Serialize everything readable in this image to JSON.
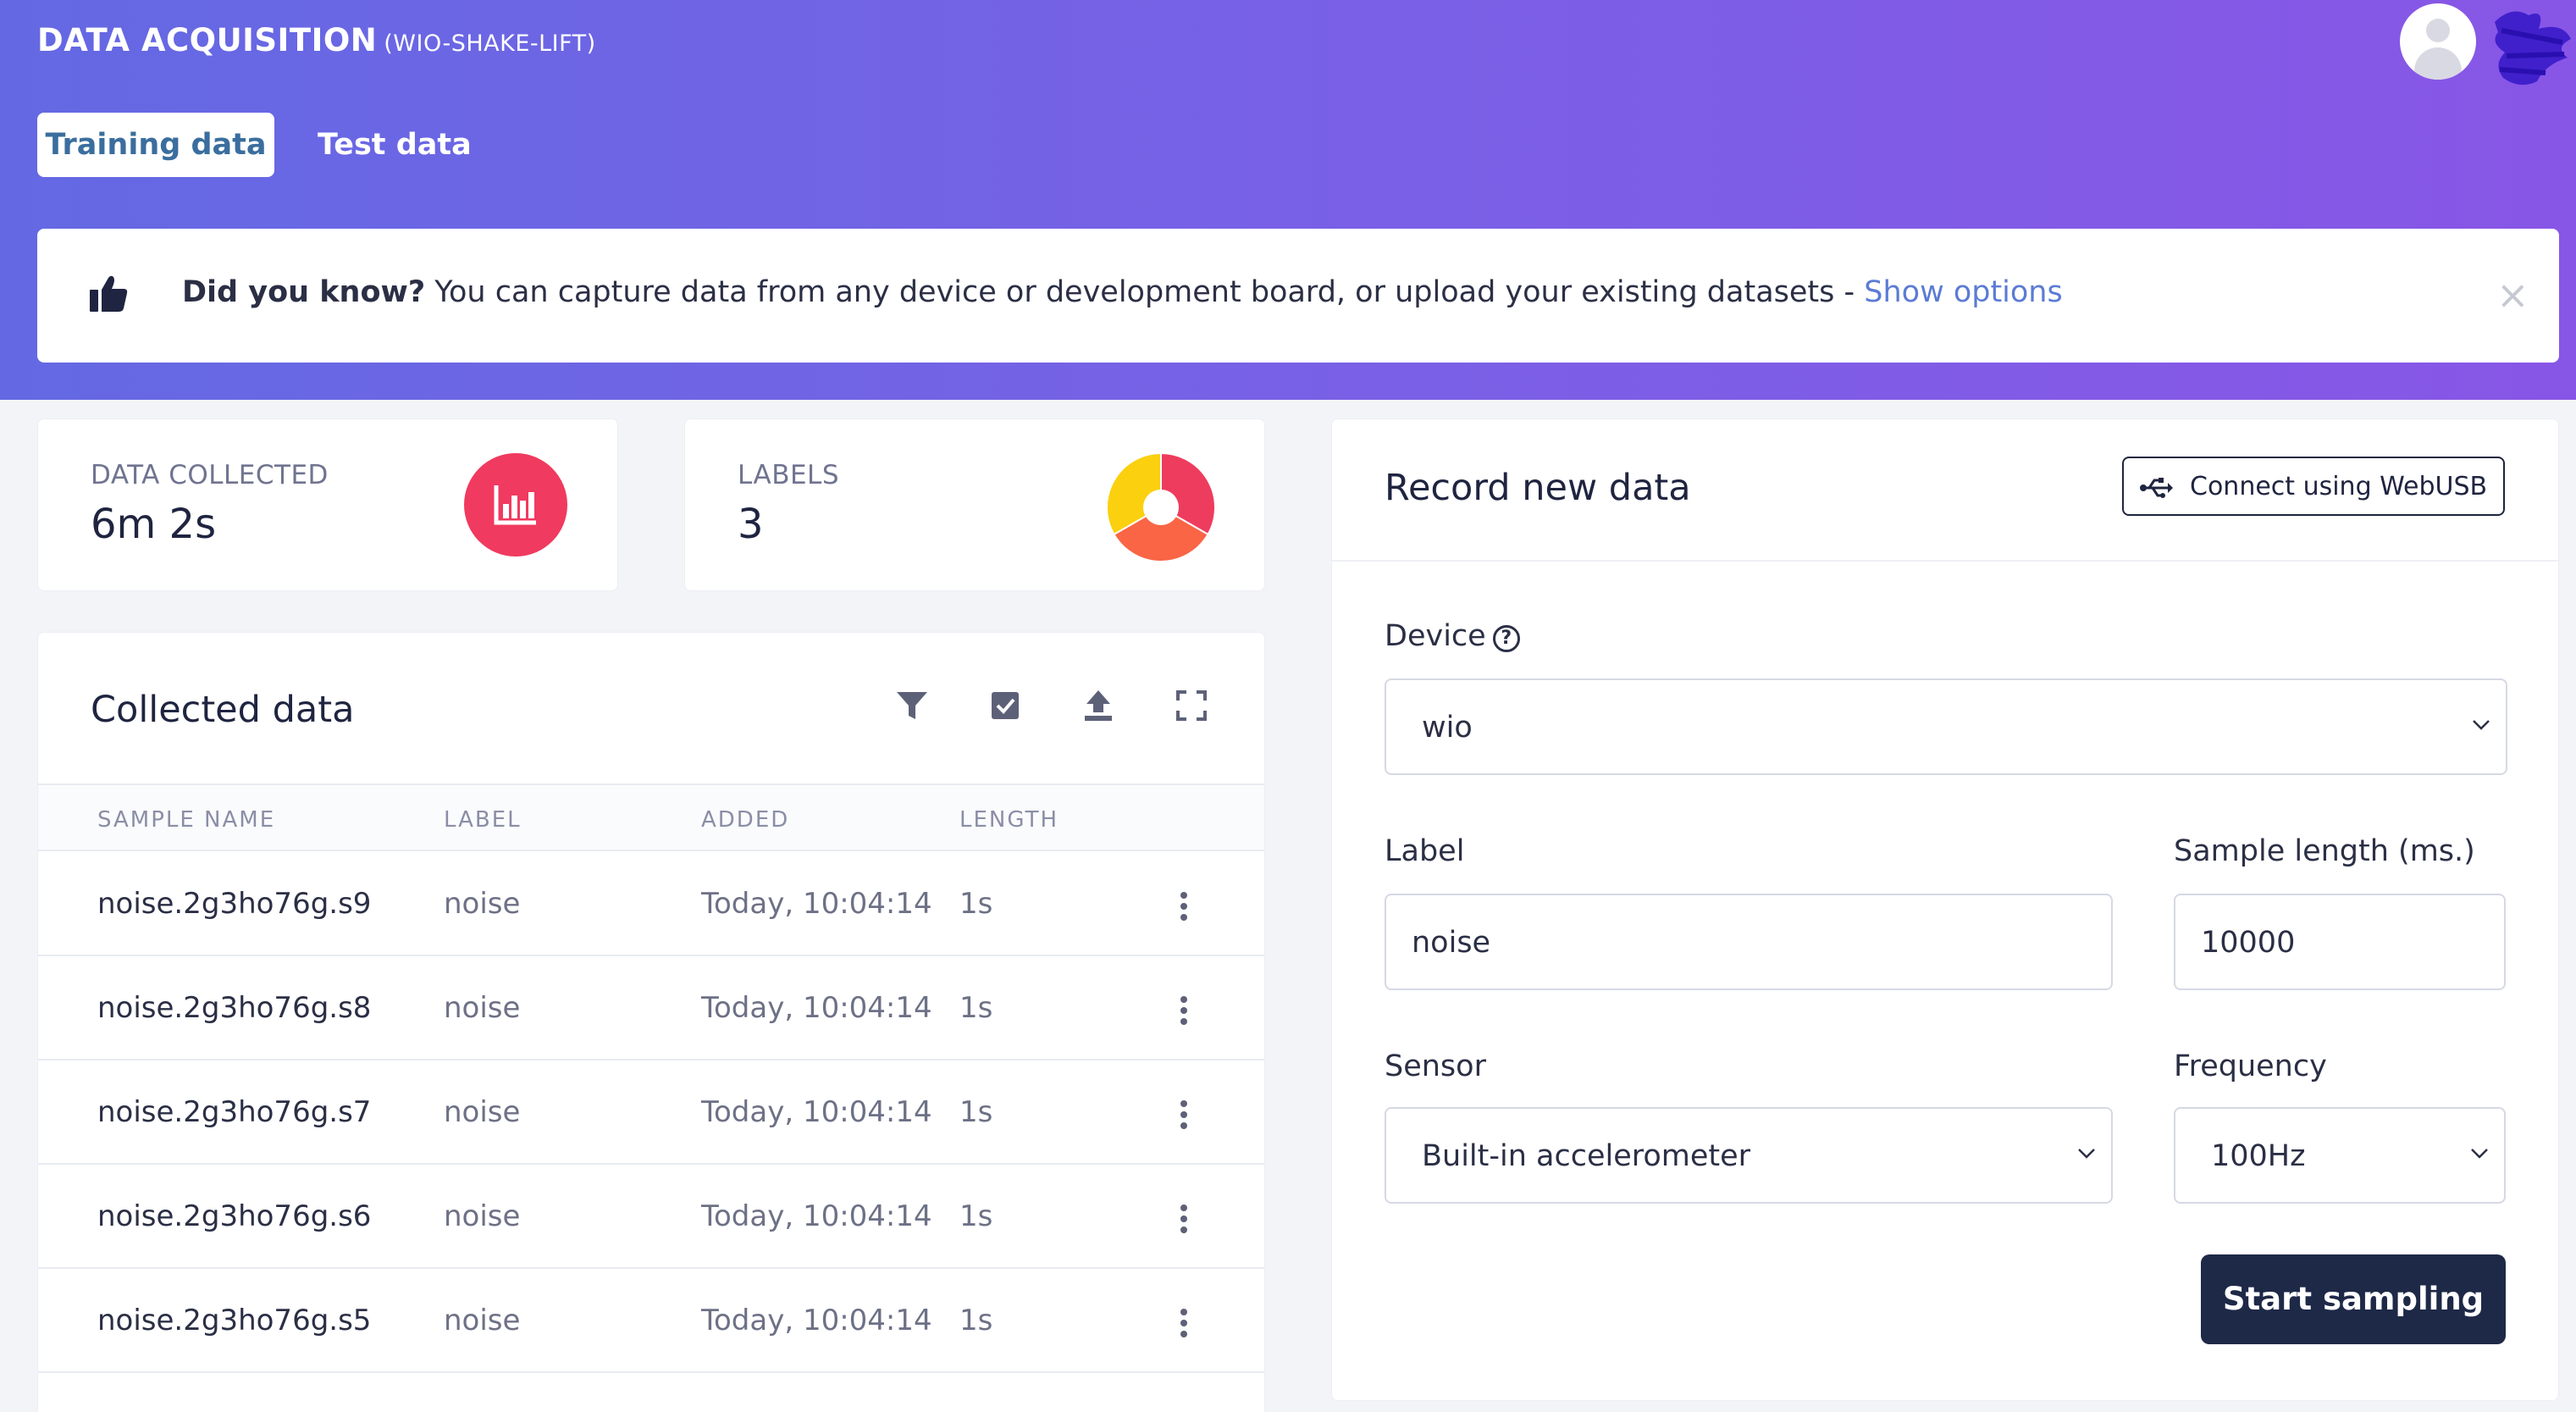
{
  "header": {
    "title": "DATA ACQUISITION",
    "project": "(WIO-SHAKE-LIFT)"
  },
  "tabs": [
    {
      "label": "Training data",
      "active": true
    },
    {
      "label": "Test data",
      "active": false
    }
  ],
  "tip": {
    "bold": "Did you know?",
    "text": " You can capture data from any device or development board, or upload your existing datasets - ",
    "link": "Show options",
    "close": "×"
  },
  "stats": {
    "data_collected": {
      "label": "DATA COLLECTED",
      "value": "6m 2s"
    },
    "labels": {
      "label": "LABELS",
      "value": "3"
    }
  },
  "label_distribution": [
    {
      "color": "#ee3c5e",
      "fraction": 0.333
    },
    {
      "color": "#f96545",
      "fraction": 0.334
    },
    {
      "color": "#fbd00e",
      "fraction": 0.333
    }
  ],
  "collected": {
    "title": "Collected data",
    "toolbar_icons": [
      "filter-icon",
      "checkbox-icon",
      "upload-icon",
      "expand-icon"
    ],
    "columns": [
      "SAMPLE NAME",
      "LABEL",
      "ADDED",
      "LENGTH"
    ],
    "rows": [
      {
        "name": "noise.2g3ho76g.s9",
        "label": "noise",
        "added": "Today, 10:04:14",
        "length": "1s"
      },
      {
        "name": "noise.2g3ho76g.s8",
        "label": "noise",
        "added": "Today, 10:04:14",
        "length": "1s"
      },
      {
        "name": "noise.2g3ho76g.s7",
        "label": "noise",
        "added": "Today, 10:04:14",
        "length": "1s"
      },
      {
        "name": "noise.2g3ho76g.s6",
        "label": "noise",
        "added": "Today, 10:04:14",
        "length": "1s"
      },
      {
        "name": "noise.2g3ho76g.s5",
        "label": "noise",
        "added": "Today, 10:04:14",
        "length": "1s"
      }
    ]
  },
  "record": {
    "title": "Record new data",
    "webusb_label": "Connect using WebUSB",
    "device_label": "Device",
    "device_help": "?",
    "device_value": "wio",
    "label_label": "Label",
    "label_value": "noise",
    "sample_length_label": "Sample length (ms.)",
    "sample_length_value": "10000",
    "sensor_label": "Sensor",
    "sensor_value": "Built-in accelerometer",
    "frequency_label": "Frequency",
    "frequency_value": "100Hz",
    "start_label": "Start sampling"
  },
  "colors": {
    "header_gradient_start": "#6469e3",
    "header_gradient_end": "#8856e6",
    "active_tab_text": "#3a6e9e",
    "link": "#5b7bd5",
    "stat_icon": "#f03a5f",
    "primary_button": "#1e2947"
  }
}
